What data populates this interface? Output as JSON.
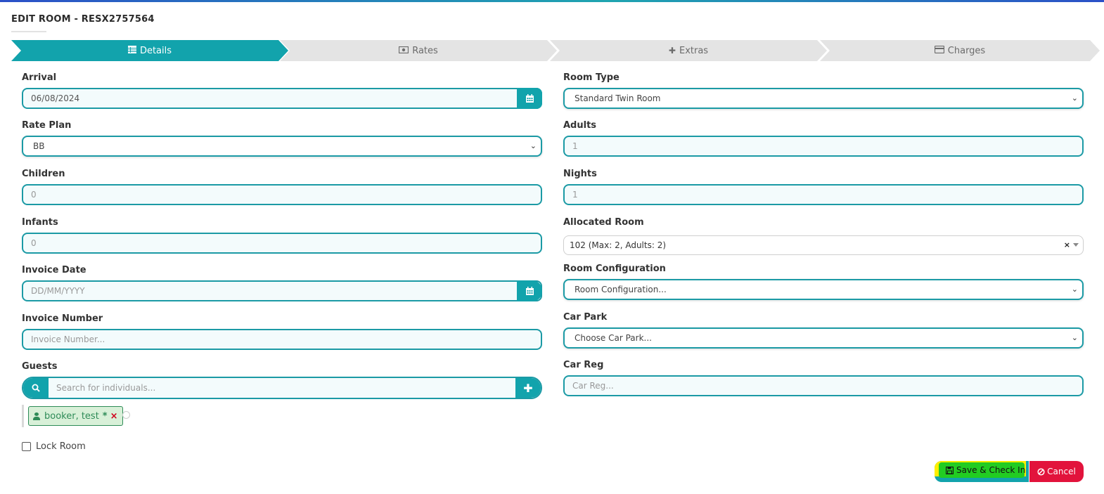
{
  "modal": {
    "title": "EDIT ROOM - RESX2757564"
  },
  "tabs": [
    {
      "label": "Details",
      "icon": "list-icon",
      "active": true
    },
    {
      "label": "Rates",
      "icon": "money-icon",
      "active": false
    },
    {
      "label": "Extras",
      "icon": "plus-icon",
      "active": false
    },
    {
      "label": "Charges",
      "icon": "credit-card-icon",
      "active": false
    }
  ],
  "left": {
    "arrival": {
      "label": "Arrival",
      "value": "06/08/2024"
    },
    "rate_plan": {
      "label": "Rate Plan",
      "value": "BB"
    },
    "children": {
      "label": "Children",
      "value": "0"
    },
    "infants": {
      "label": "Infants",
      "value": "0"
    },
    "invoice_date": {
      "label": "Invoice Date",
      "placeholder": "DD/MM/YYYY"
    },
    "invoice_number": {
      "label": "Invoice Number",
      "placeholder": "Invoice Number..."
    },
    "guests": {
      "label": "Guests",
      "placeholder": "Search for individuals...",
      "chip_name": "booker, test",
      "chip_star": "*",
      "chip_remove": "×"
    },
    "lock_room": {
      "label": "Lock Room",
      "checked": false
    }
  },
  "right": {
    "room_type": {
      "label": "Room Type",
      "value": "Standard Twin Room"
    },
    "adults": {
      "label": "Adults",
      "value": "1"
    },
    "nights": {
      "label": "Nights",
      "value": "1"
    },
    "allocated_room": {
      "label": "Allocated Room",
      "value": "102 (Max: 2, Adults: 2)",
      "clear": "×"
    },
    "room_configuration": {
      "label": "Room Configuration",
      "value": "Room Configuration..."
    },
    "car_park": {
      "label": "Car Park",
      "value": "Choose Car Park..."
    },
    "car_reg": {
      "label": "Car Reg",
      "placeholder": "Car Reg..."
    }
  },
  "actions": {
    "save_label": "Save & Check In",
    "cancel_label": "Cancel"
  },
  "colors": {
    "accent": "#12a3ac",
    "cancel": "#e2133c",
    "guest_chip": "#2e8b57"
  }
}
